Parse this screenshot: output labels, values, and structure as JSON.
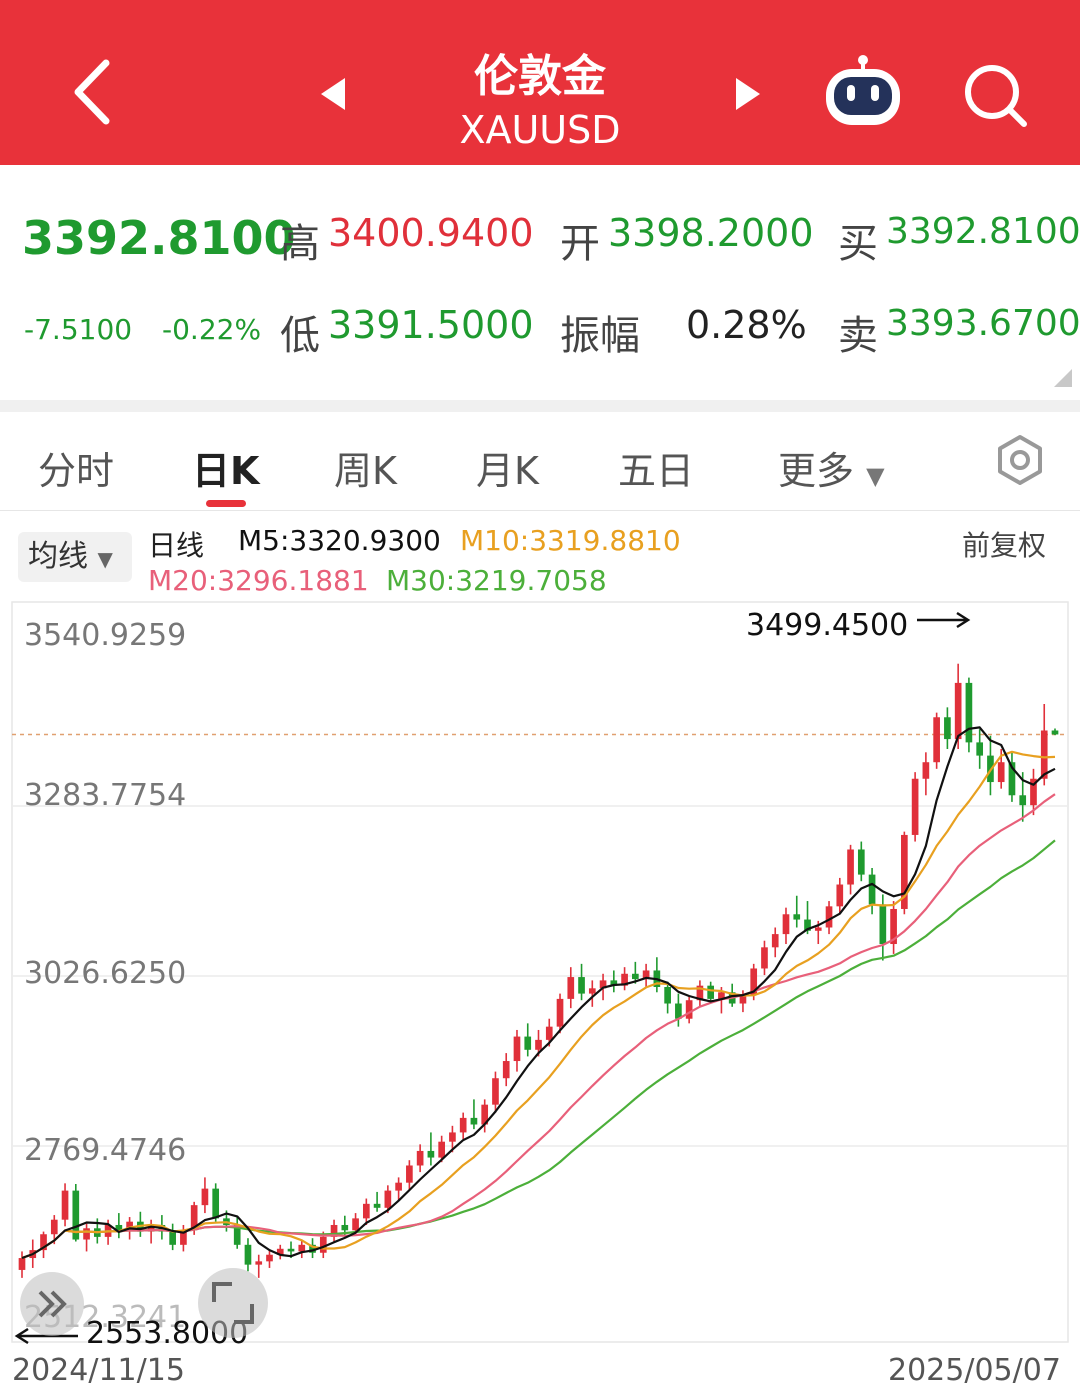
{
  "header": {
    "name": "伦敦金",
    "code": "XAUUSD"
  },
  "quote": {
    "price": "3392.8100",
    "change": "-7.5100",
    "change_pct": "-0.22%",
    "high_label": "高",
    "high": "3400.9400",
    "low_label": "低",
    "low": "3391.5000",
    "open_label": "开",
    "open": "3398.2000",
    "amp_label": "振幅",
    "amp": "0.28%",
    "buy_label": "买",
    "buy": "3392.8100",
    "sell_label": "卖",
    "sell": "3393.6700"
  },
  "tabs": [
    "分时",
    "日K",
    "周K",
    "月K",
    "五日",
    "更多"
  ],
  "indicator": {
    "chip": "均线",
    "type": "日线",
    "m5": "M5:3320.9300",
    "m10": "M10:3319.8810",
    "m20": "M20:3296.1881",
    "m30": "M30:3219.7058",
    "adjust": "前复权"
  },
  "colors": {
    "up": "#e0303a",
    "down": "#1f9a2f",
    "m5": "#111111",
    "m10": "#e8a020",
    "m20": "#e8607a",
    "m30": "#4caf3a"
  },
  "chart_data": {
    "type": "candlestick",
    "y_ticks": [
      "3540.9259",
      "3283.7754",
      "3026.6250",
      "2769.4746",
      "2512.3241"
    ],
    "x_labels": [
      "2024/11/15",
      "2025/05/07"
    ],
    "max_label": "3499.4500",
    "min_label": "2553.8000",
    "ohlc": [
      [
        2582,
        2610,
        2570,
        2600
      ],
      [
        2600,
        2628,
        2585,
        2612
      ],
      [
        2612,
        2640,
        2600,
        2636
      ],
      [
        2636,
        2665,
        2621,
        2658
      ],
      [
        2658,
        2713,
        2648,
        2702
      ],
      [
        2702,
        2712,
        2625,
        2628
      ],
      [
        2628,
        2652,
        2610,
        2645
      ],
      [
        2645,
        2660,
        2622,
        2632
      ],
      [
        2632,
        2658,
        2620,
        2650
      ],
      [
        2650,
        2668,
        2630,
        2642
      ],
      [
        2642,
        2662,
        2628,
        2655
      ],
      [
        2655,
        2670,
        2632,
        2640
      ],
      [
        2640,
        2658,
        2622,
        2650
      ],
      [
        2650,
        2665,
        2628,
        2640
      ],
      [
        2640,
        2652,
        2612,
        2620
      ],
      [
        2620,
        2650,
        2610,
        2642
      ],
      [
        2642,
        2685,
        2635,
        2680
      ],
      [
        2680,
        2722,
        2668,
        2705
      ],
      [
        2705,
        2713,
        2655,
        2660
      ],
      [
        2660,
        2672,
        2640,
        2650
      ],
      [
        2650,
        2662,
        2614,
        2620
      ],
      [
        2620,
        2630,
        2580,
        2590
      ],
      [
        2590,
        2605,
        2570,
        2595
      ],
      [
        2595,
        2612,
        2585,
        2605
      ],
      [
        2605,
        2620,
        2598,
        2614
      ],
      [
        2614,
        2625,
        2600,
        2610
      ],
      [
        2610,
        2628,
        2600,
        2620
      ],
      [
        2620,
        2630,
        2600,
        2608
      ],
      [
        2608,
        2640,
        2600,
        2632
      ],
      [
        2632,
        2658,
        2625,
        2650
      ],
      [
        2650,
        2664,
        2630,
        2642
      ],
      [
        2642,
        2668,
        2636,
        2660
      ],
      [
        2660,
        2690,
        2650,
        2682
      ],
      [
        2682,
        2700,
        2670,
        2676
      ],
      [
        2676,
        2710,
        2668,
        2702
      ],
      [
        2702,
        2722,
        2688,
        2714
      ],
      [
        2714,
        2748,
        2702,
        2740
      ],
      [
        2740,
        2772,
        2730,
        2762
      ],
      [
        2762,
        2790,
        2740,
        2752
      ],
      [
        2752,
        2785,
        2745,
        2776
      ],
      [
        2776,
        2800,
        2760,
        2790
      ],
      [
        2790,
        2820,
        2780,
        2812
      ],
      [
        2812,
        2840,
        2795,
        2802
      ],
      [
        2802,
        2840,
        2790,
        2832
      ],
      [
        2832,
        2882,
        2820,
        2872
      ],
      [
        2872,
        2910,
        2860,
        2898
      ],
      [
        2898,
        2945,
        2882,
        2935
      ],
      [
        2935,
        2955,
        2905,
        2915
      ],
      [
        2915,
        2945,
        2905,
        2930
      ],
      [
        2930,
        2962,
        2920,
        2950
      ],
      [
        2950,
        3000,
        2940,
        2992
      ],
      [
        2992,
        3040,
        2978,
        3025
      ],
      [
        3025,
        3045,
        2990,
        3000
      ],
      [
        3000,
        3020,
        2980,
        3008
      ],
      [
        3008,
        3030,
        2990,
        3020
      ],
      [
        3020,
        3035,
        3002,
        3012
      ],
      [
        3012,
        3040,
        3005,
        3030
      ],
      [
        3030,
        3048,
        3015,
        3022
      ],
      [
        3022,
        3045,
        3010,
        3035
      ],
      [
        3035,
        3055,
        3002,
        3010
      ],
      [
        3010,
        3018,
        2970,
        2985
      ],
      [
        2985,
        3000,
        2950,
        2962
      ],
      [
        2962,
        2995,
        2955,
        2990
      ],
      [
        2990,
        3020,
        2980,
        3012
      ],
      [
        3012,
        3018,
        2985,
        2992
      ],
      [
        2992,
        3010,
        2970,
        3002
      ],
      [
        3002,
        3015,
        2980,
        2985
      ],
      [
        2985,
        3005,
        2972,
        2998
      ],
      [
        2998,
        3045,
        2990,
        3038
      ],
      [
        3038,
        3080,
        3028,
        3070
      ],
      [
        3070,
        3100,
        3055,
        3090
      ],
      [
        3090,
        3130,
        3075,
        3120
      ],
      [
        3120,
        3148,
        3100,
        3112
      ],
      [
        3112,
        3140,
        3090,
        3095
      ],
      [
        3095,
        3110,
        3075,
        3100
      ],
      [
        3100,
        3140,
        3090,
        3132
      ],
      [
        3132,
        3175,
        3120,
        3165
      ],
      [
        3165,
        3225,
        3150,
        3218
      ],
      [
        3218,
        3230,
        3170,
        3180
      ],
      [
        3180,
        3190,
        3120,
        3135
      ],
      [
        3135,
        3150,
        3050,
        3075
      ],
      [
        3075,
        3140,
        3060,
        3128
      ],
      [
        3128,
        3245,
        3120,
        3240
      ],
      [
        3240,
        3335,
        3230,
        3325
      ],
      [
        3325,
        3365,
        3300,
        3350
      ],
      [
        3350,
        3425,
        3340,
        3418
      ],
      [
        3418,
        3433,
        3370,
        3385
      ],
      [
        3385,
        3499,
        3370,
        3470
      ],
      [
        3470,
        3478,
        3365,
        3380
      ],
      [
        3380,
        3400,
        3340,
        3360
      ],
      [
        3360,
        3390,
        3300,
        3320
      ],
      [
        3320,
        3370,
        3310,
        3350
      ],
      [
        3350,
        3365,
        3290,
        3300
      ],
      [
        3300,
        3335,
        3260,
        3285
      ],
      [
        3285,
        3340,
        3270,
        3325
      ],
      [
        3325,
        3438,
        3315,
        3398
      ],
      [
        3398,
        3401,
        3391,
        3392
      ]
    ]
  }
}
